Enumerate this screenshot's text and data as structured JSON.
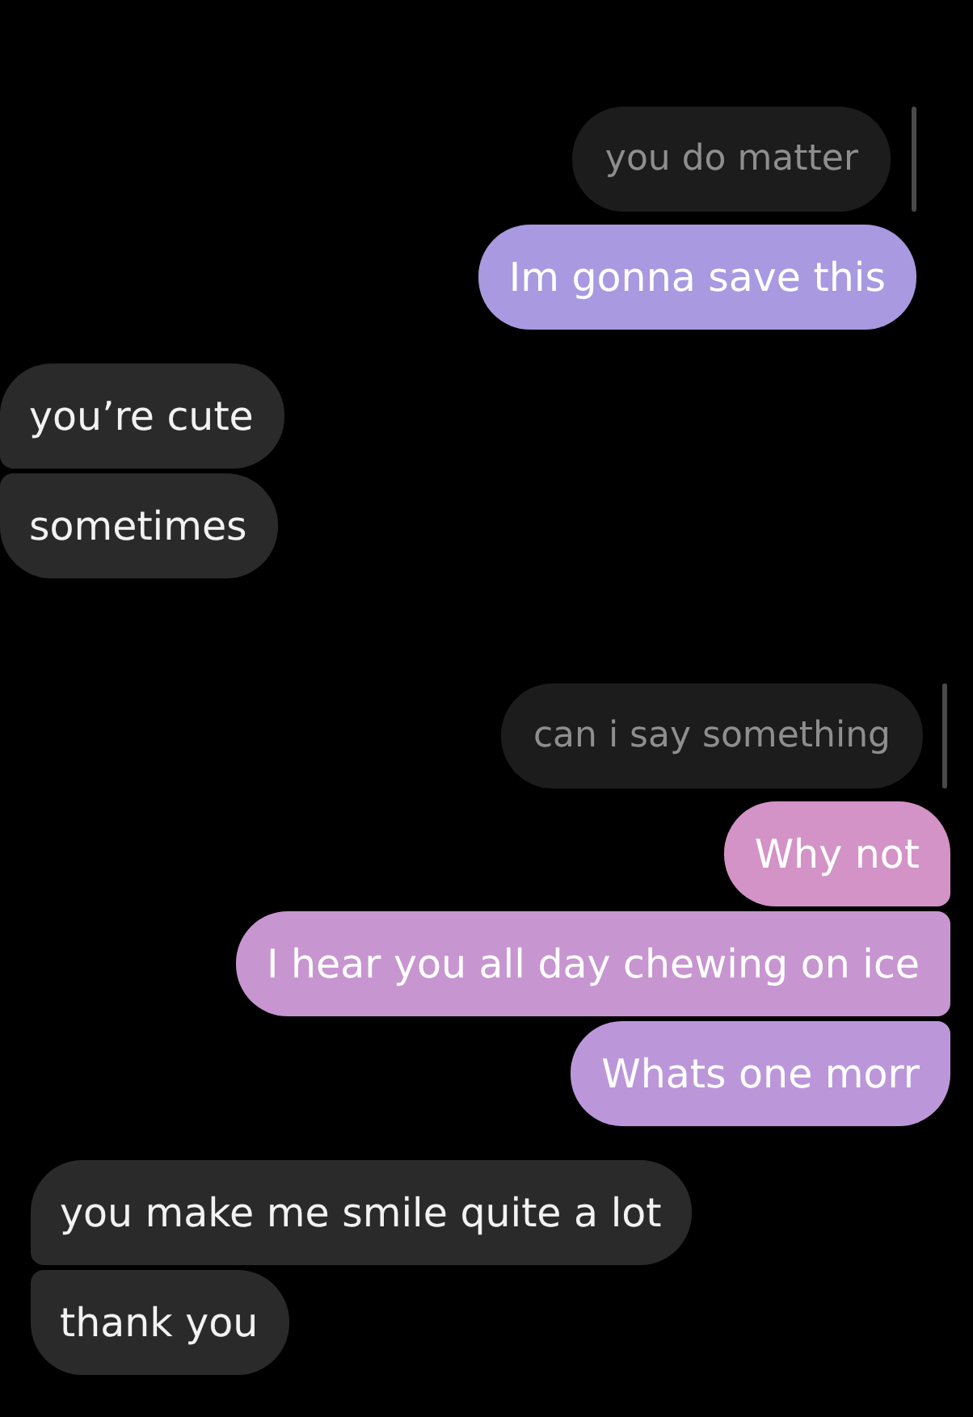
{
  "panels": [
    {
      "messages": [
        {
          "kind": "reply_quote",
          "text": "you do matter"
        },
        {
          "kind": "sent",
          "text": "Im gonna save this",
          "color": "#a899e0"
        },
        {
          "kind": "received",
          "text": "you’re cute"
        },
        {
          "kind": "received",
          "text": "sometimes"
        }
      ]
    },
    {
      "messages": [
        {
          "kind": "reply_quote",
          "text": "can i say something"
        },
        {
          "kind": "sent",
          "text": "Why not",
          "color": "#d393c6"
        },
        {
          "kind": "sent",
          "text": "I hear you all day chewing on ice",
          "color": "#c795d0"
        },
        {
          "kind": "sent",
          "text": "Whats one morr",
          "color": "#bb97da"
        },
        {
          "kind": "received",
          "text": "you make me smile quite a lot"
        },
        {
          "kind": "received",
          "text": "thank you"
        }
      ]
    }
  ]
}
